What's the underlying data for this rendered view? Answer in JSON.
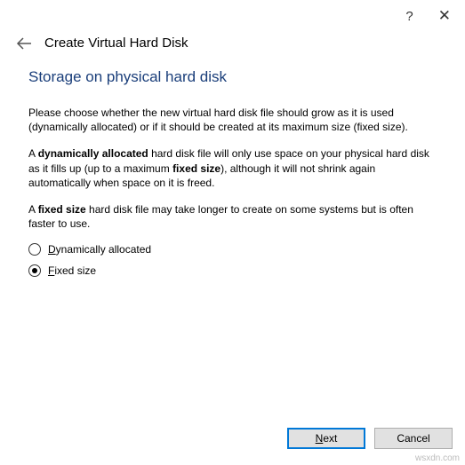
{
  "titlebar": {
    "help": "?",
    "close": "✕"
  },
  "header": {
    "wizard_title": "Create Virtual Hard Disk"
  },
  "content": {
    "heading": "Storage on physical hard disk",
    "para1": "Please choose whether the new virtual hard disk file should grow as it is used (dynamically allocated) or if it should be created at its maximum size (fixed size).",
    "para2_a": "A ",
    "para2_b": "dynamically allocated",
    "para2_c": " hard disk file will only use space on your physical hard disk as it fills up (up to a maximum ",
    "para2_d": "fixed size",
    "para2_e": "), although it will not shrink again automatically when space on it is freed.",
    "para3_a": "A ",
    "para3_b": "fixed size",
    "para3_c": " hard disk file may take longer to create on some systems but is often faster to use.",
    "options": {
      "opt1_u": "D",
      "opt1_rest": "ynamically allocated",
      "opt2_u": "F",
      "opt2_rest": "ixed size"
    }
  },
  "footer": {
    "next_u": "N",
    "next_rest": "ext",
    "cancel": "Cancel"
  },
  "watermark": "wsxdn.com"
}
